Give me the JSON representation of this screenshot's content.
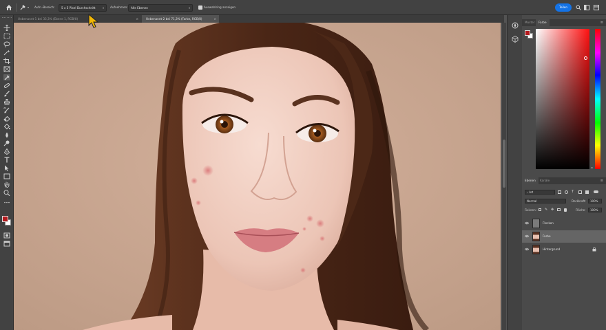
{
  "options_bar": {
    "sample_size_label": "Aufn.-Bereich:",
    "sample_size_value": "5 x 5 Pixel Durchschnitt",
    "sample_label": "Aufnehmen:",
    "sample_value": "Alle Ebenen",
    "show_ring_label": "Auswahlring anzeigen",
    "share_label": "Teilen"
  },
  "tabs": [
    {
      "label": "Unbenannt-1 bei 33,3% (Ebene 1, RGB/8)",
      "active": false
    },
    {
      "label": "Unbenannt-2 bei 71,3% (Farbe, RGB/8)",
      "active": true
    }
  ],
  "colors": {
    "foreground": "#b3191d",
    "background": "#ffffff",
    "accent": "#1473e6",
    "canvas_backdrop": "#c5a38e"
  },
  "color_panel": {
    "tabs": [
      "Muster",
      "Farbe"
    ],
    "active_tab": "Farbe"
  },
  "layers_panel": {
    "tabs": [
      "Ebenen",
      "Kanäle"
    ],
    "active_tab": "Ebenen",
    "kind_filter": "Art",
    "blend_mode": "Normal",
    "opacity_label": "Deckkraft:",
    "opacity_value": "100%",
    "lock_label": "Fixieren:",
    "fill_label": "Fläche:",
    "fill_value": "100%",
    "layers": [
      {
        "name": "Flecken",
        "selected": false,
        "thumbnail": "gray"
      },
      {
        "name": "Farbe",
        "selected": true,
        "thumbnail": "photo"
      },
      {
        "name": "Hintergrund",
        "selected": false,
        "thumbnail": "photo",
        "locked": true
      }
    ]
  },
  "toolbar_icons": [
    "move-icon",
    "marquee-icon",
    "lasso-icon",
    "magic-wand-icon",
    "crop-icon",
    "frame-icon",
    "eyedropper-icon",
    "healing-brush-icon",
    "brush-icon",
    "clone-stamp-icon",
    "history-brush-icon",
    "eraser-icon",
    "paint-bucket-icon",
    "blur-icon",
    "dodge-icon",
    "pen-icon",
    "type-icon",
    "path-selection-icon",
    "rectangle-icon",
    "hand-icon",
    "zoom-icon",
    "more-tools-icon"
  ]
}
